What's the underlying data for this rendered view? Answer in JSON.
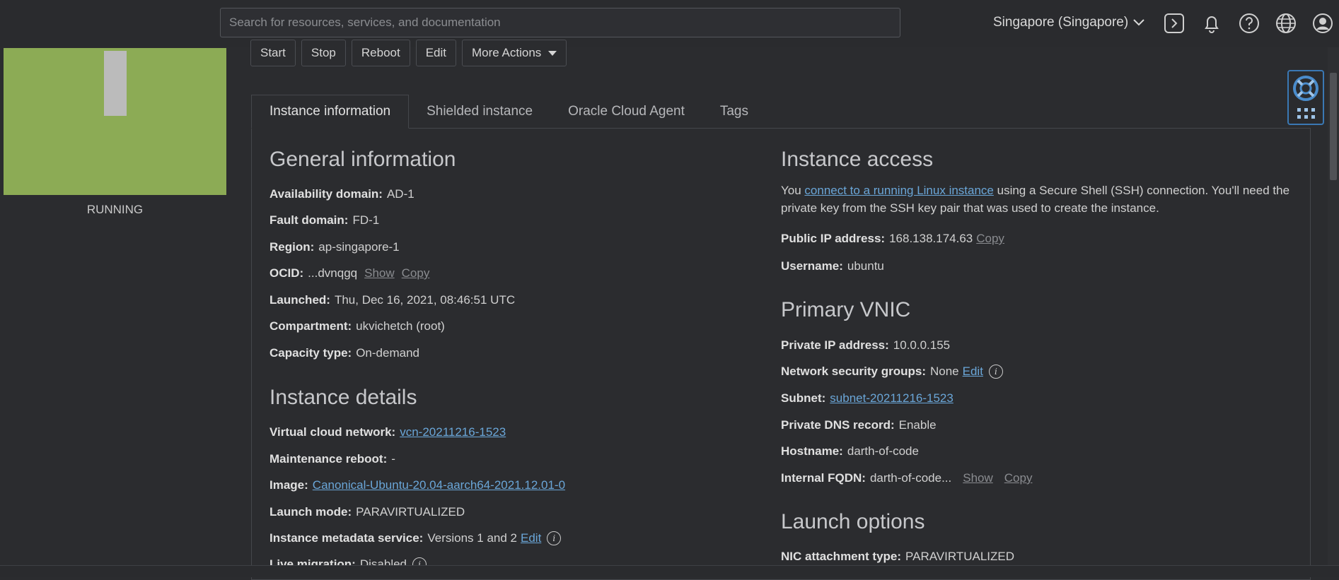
{
  "topbar": {
    "search_placeholder": "Search for resources, services, and documentation",
    "region": "Singapore (Singapore)"
  },
  "instance": {
    "status": "RUNNING"
  },
  "actions": [
    "Start",
    "Stop",
    "Reboot",
    "Edit",
    "More Actions"
  ],
  "tabs": [
    "Instance information",
    "Shielded instance",
    "Oracle Cloud Agent",
    "Tags"
  ],
  "general": {
    "heading": "General information",
    "availability_domain": {
      "label": "Availability domain:",
      "value": "AD-1"
    },
    "fault_domain": {
      "label": "Fault domain:",
      "value": "FD-1"
    },
    "region": {
      "label": "Region:",
      "value": "ap-singapore-1"
    },
    "ocid": {
      "label": "OCID:",
      "value": "...dvnqgq",
      "show": "Show",
      "copy": "Copy"
    },
    "launched": {
      "label": "Launched:",
      "value": "Thu, Dec 16, 2021, 08:46:51 UTC"
    },
    "compartment": {
      "label": "Compartment:",
      "value": "ukvichetch (root)"
    },
    "capacity_type": {
      "label": "Capacity type:",
      "value": "On-demand"
    }
  },
  "details": {
    "heading": "Instance details",
    "vcn": {
      "label": "Virtual cloud network:",
      "value": "vcn-20211216-1523"
    },
    "maintenance": {
      "label": "Maintenance reboot:",
      "value": "-"
    },
    "image": {
      "label": "Image:",
      "value": "Canonical-Ubuntu-20.04-aarch64-2021.12.01-0"
    },
    "launch_mode": {
      "label": "Launch mode:",
      "value": "PARAVIRTUALIZED"
    },
    "metadata": {
      "label": "Instance metadata service:",
      "value": "Versions 1 and 2",
      "edit": "Edit"
    },
    "live_migration": {
      "label": "Live migration:",
      "value": "Disabled"
    }
  },
  "access": {
    "heading": "Instance access",
    "text_before": "You ",
    "link": "connect to a running Linux instance",
    "text_after": " using a Secure Shell (SSH) connection. You'll need the private key from the SSH key pair that was used to create the instance.",
    "public_ip": {
      "label": "Public IP address:",
      "value": "168.138.174.63",
      "copy": "Copy"
    },
    "username": {
      "label": "Username:",
      "value": "ubuntu"
    }
  },
  "vnic": {
    "heading": "Primary VNIC",
    "private_ip": {
      "label": "Private IP address:",
      "value": "10.0.0.155"
    },
    "nsg": {
      "label": "Network security groups:",
      "value": "None",
      "edit": "Edit"
    },
    "subnet": {
      "label": "Subnet:",
      "value": "subnet-20211216-1523"
    },
    "dns": {
      "label": "Private DNS record:",
      "value": "Enable"
    },
    "hostname": {
      "label": "Hostname:",
      "value": "darth-of-code"
    },
    "fqdn": {
      "label": "Internal FQDN:",
      "value": "darth-of-code...",
      "show": "Show",
      "copy": "Copy"
    }
  },
  "launch": {
    "heading": "Launch options",
    "nic": {
      "label": "NIC attachment type:",
      "value": "PARAVIRTUALIZED"
    }
  }
}
